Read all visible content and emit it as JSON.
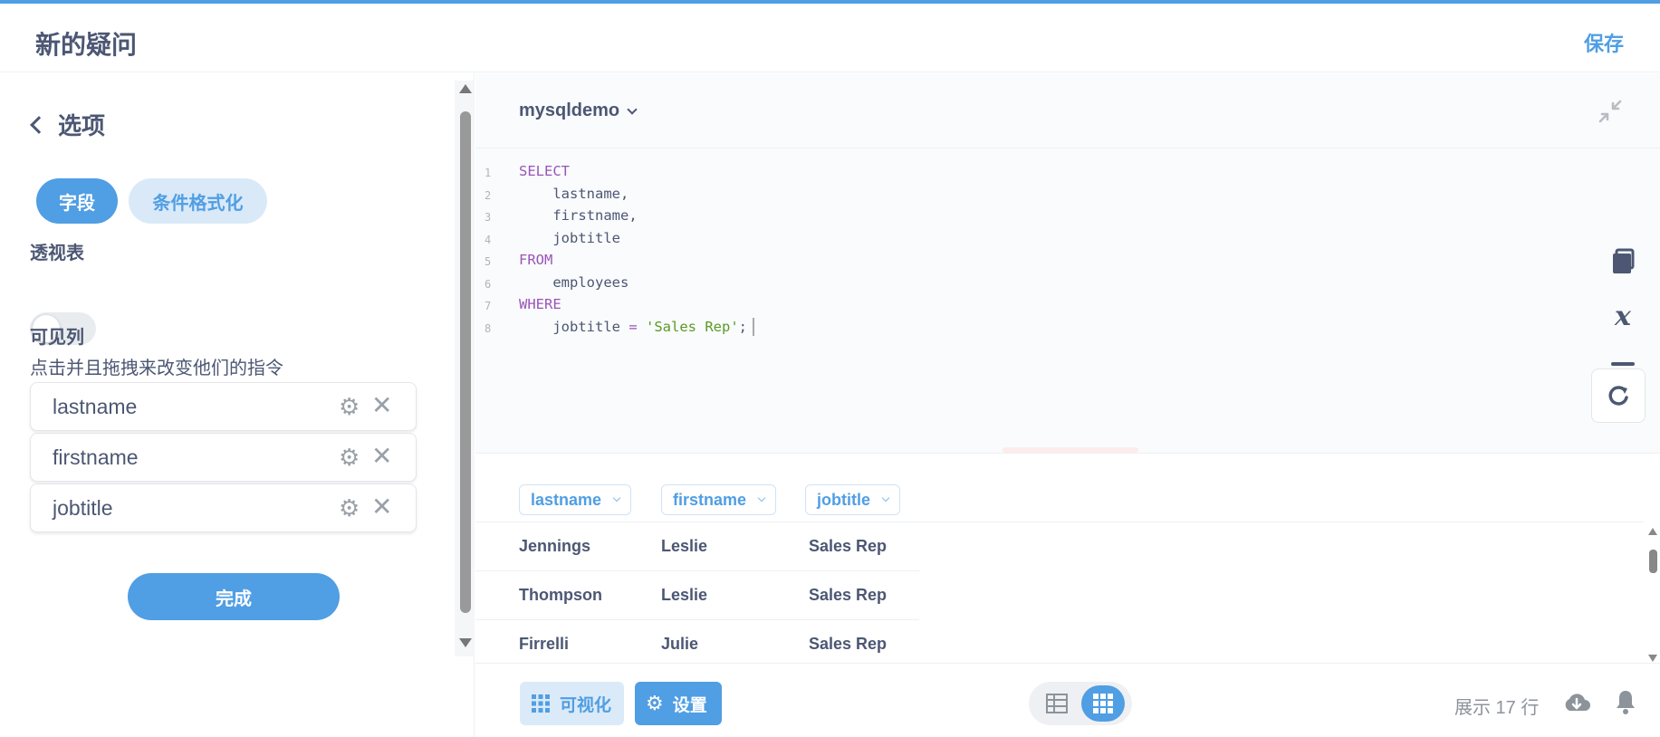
{
  "header": {
    "title": "新的疑问",
    "save_label": "保存"
  },
  "sidebar": {
    "back_label": "选项",
    "tabs": [
      {
        "label": "字段",
        "active": true
      },
      {
        "label": "条件格式化",
        "active": false
      }
    ],
    "pivot_label": "透视表",
    "pivot_enabled": false,
    "visible_columns_label": "可见列",
    "visible_columns_hint": "点击并且拖拽来改变他们的指令",
    "columns": [
      {
        "name": "lastname"
      },
      {
        "name": "firstname"
      },
      {
        "name": "jobtitle"
      }
    ],
    "done_label": "完成"
  },
  "editor": {
    "database": "mysqldemo",
    "lines": [
      {
        "n": "1",
        "parts": [
          {
            "t": "SELECT",
            "c": "kw"
          }
        ]
      },
      {
        "n": "2",
        "parts": [
          {
            "t": "    lastname,",
            "c": ""
          }
        ]
      },
      {
        "n": "3",
        "parts": [
          {
            "t": "    firstname,",
            "c": ""
          }
        ]
      },
      {
        "n": "4",
        "parts": [
          {
            "t": "    jobtitle",
            "c": ""
          }
        ]
      },
      {
        "n": "5",
        "parts": [
          {
            "t": "FROM",
            "c": "kw"
          }
        ]
      },
      {
        "n": "6",
        "parts": [
          {
            "t": "    employees",
            "c": ""
          }
        ]
      },
      {
        "n": "7",
        "parts": [
          {
            "t": "WHERE",
            "c": "kw"
          }
        ]
      },
      {
        "n": "8",
        "parts": [
          {
            "t": "    jobtitle ",
            "c": ""
          },
          {
            "t": "=",
            "c": "op"
          },
          {
            "t": " ",
            "c": ""
          },
          {
            "t": "'Sales Rep'",
            "c": "str"
          },
          {
            "t": ";",
            "c": ""
          }
        ]
      }
    ]
  },
  "results": {
    "columns": [
      "lastname",
      "firstname",
      "jobtitle"
    ],
    "rows": [
      [
        "Jennings",
        "Leslie",
        "Sales Rep"
      ],
      [
        "Thompson",
        "Leslie",
        "Sales Rep"
      ],
      [
        "Firrelli",
        "Julie",
        "Sales Rep"
      ]
    ]
  },
  "footer": {
    "visualize_label": "可视化",
    "settings_label": "设置",
    "row_count": "展示 17 行"
  },
  "colors": {
    "accent": "#509ee3",
    "text": "#4c5773",
    "keyword": "#9a54b8",
    "string": "#5a9a26"
  }
}
